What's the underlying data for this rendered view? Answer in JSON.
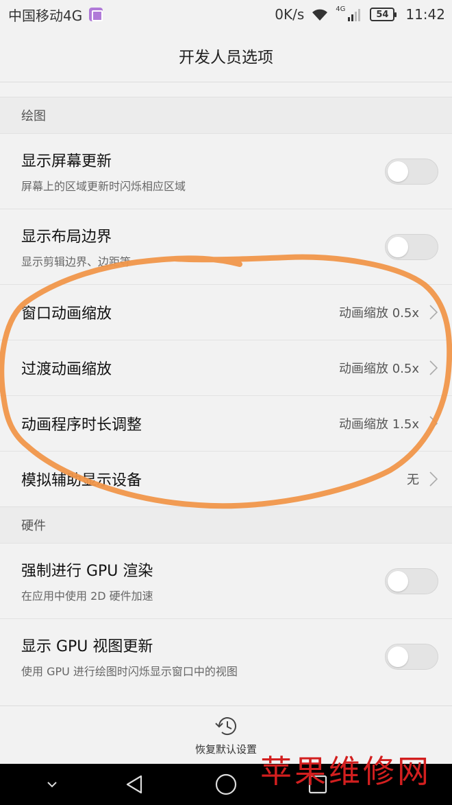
{
  "status_bar": {
    "carrier": "中国移动4G",
    "speed": "0K/s",
    "network": "4G",
    "battery": "54",
    "time": "11:42"
  },
  "app_bar": {
    "title": "开发人员选项"
  },
  "sections": {
    "drawing": {
      "header": "绘图",
      "show_screen_updates": {
        "title": "显示屏幕更新",
        "subtitle": "屏幕上的区域更新时闪烁相应区域",
        "enabled": false
      },
      "show_layout_bounds": {
        "title": "显示布局边界",
        "subtitle": "显示剪辑边界、边距等",
        "enabled": false
      },
      "window_animation_scale": {
        "title": "窗口动画缩放",
        "value": "动画缩放 0.5x"
      },
      "transition_animation_scale": {
        "title": "过渡动画缩放",
        "value": "动画缩放 0.5x"
      },
      "animator_duration_scale": {
        "title": "动画程序时长调整",
        "value": "动画缩放 1.5x"
      },
      "simulate_secondary_display": {
        "title": "模拟辅助显示设备",
        "value": "无"
      }
    },
    "hardware": {
      "header": "硬件",
      "force_gpu_rendering": {
        "title": "强制进行 GPU 渲染",
        "subtitle": "在应用中使用 2D 硬件加速",
        "enabled": false
      },
      "show_gpu_view_updates": {
        "title": "显示 GPU 视图更新",
        "subtitle": "使用 GPU 进行绘图时闪烁显示窗口中的视图",
        "enabled": false
      }
    }
  },
  "bottom": {
    "reset_label": "恢复默认设置"
  },
  "watermark": "苹果维修网",
  "colors": {
    "annotation": "#f0964a",
    "watermark": "#d21f1f",
    "sim_icon": "#b07ad8"
  }
}
